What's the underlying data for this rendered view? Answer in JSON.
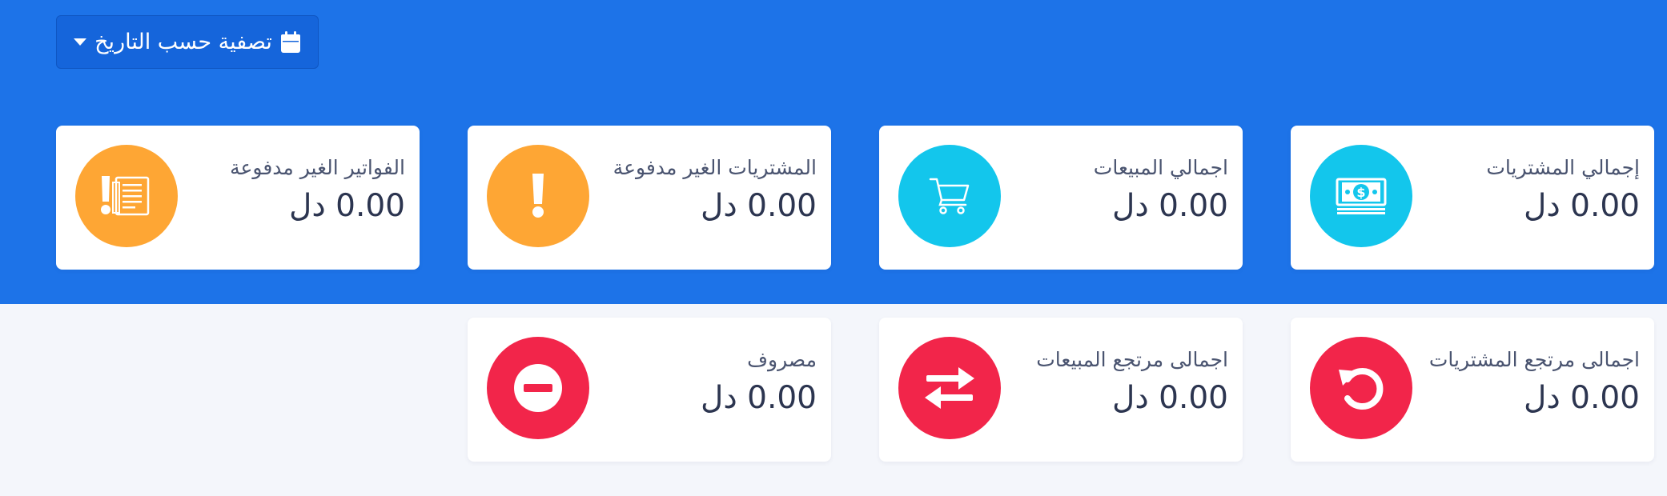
{
  "filter": {
    "label": "تصفية حسب التاريخ",
    "icon": "calendar-icon",
    "caret_icon": "caret-down-icon"
  },
  "colors": {
    "hero": "#1d73e8",
    "cyan": "#13c6ec",
    "orange": "#fea634",
    "red": "#f2254a"
  },
  "cards": [
    {
      "label": "إجمالي المشتريات",
      "value": "0.00 دل",
      "icon": "money-icon",
      "color": "cyan"
    },
    {
      "label": "اجمالي المبيعات",
      "value": "0.00 دل",
      "icon": "cart-icon",
      "color": "cyan"
    },
    {
      "label": "المشتريات الغير مدفوعة",
      "value": "0.00 دل",
      "icon": "exclamation-icon",
      "color": "orange"
    },
    {
      "label": "الفواتير الغير مدفوعة",
      "value": "0.00 دل",
      "icon": "unpaid-invoice-icon",
      "color": "orange"
    },
    {
      "label": "اجمالى مرتجع المشتريات",
      "value": "0.00 دل",
      "icon": "undo-icon",
      "color": "red"
    },
    {
      "label": "اجمالى مرتجع المبيعات",
      "value": "0.00 دل",
      "icon": "exchange-icon",
      "color": "red"
    },
    {
      "label": "مصروف",
      "value": "0.00 دل",
      "icon": "minus-circle-icon",
      "color": "red"
    }
  ]
}
